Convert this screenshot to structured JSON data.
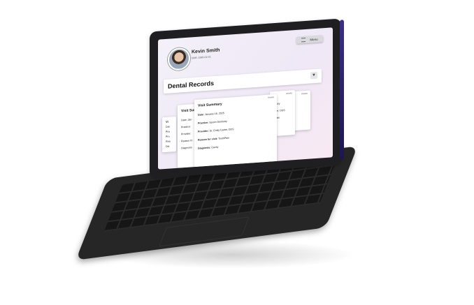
{
  "user": {
    "name": "Kevin Smith",
    "dob": "DOB: 1990-01-01"
  },
  "header": {
    "menu_label": "Menu"
  },
  "page": {
    "title": "Dental Records"
  },
  "back_card": {
    "title": "Visit Sum",
    "rows": [
      "Date: Jan",
      "Practice:",
      "Provider:",
      "Reason fo",
      "Diagnosis"
    ]
  },
  "front_card": {
    "title": "Visit Summary",
    "rows": [
      {
        "label": "Date:",
        "value": "January 16, 2025"
      },
      {
        "label": "Practice:",
        "value": "Spoon Dentistry"
      },
      {
        "label": "Provider:",
        "value": "Dr. Emily Carter, DDS"
      },
      {
        "label": "Reason for visit:",
        "value": "ToothPain"
      },
      {
        "label": "Diagnosis:",
        "value": "Cavity"
      }
    ],
    "tag": "ROWID"
  },
  "right_card": {
    "rows": [
      "ntistry",
      "arter, DDS",
      "hPain"
    ],
    "tag": "ROWID"
  },
  "far_right_card": {
    "tag": "ROWID"
  },
  "left_peek": {
    "rows": [
      "Vi",
      "Dat",
      "Pra",
      "Pro",
      "Rea",
      "Dia"
    ]
  }
}
